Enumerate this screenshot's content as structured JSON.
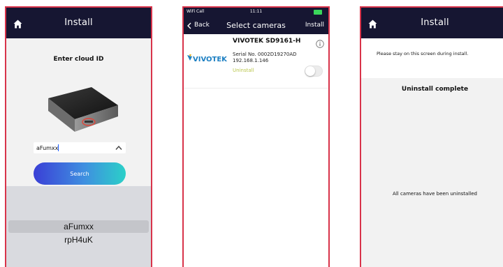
{
  "screen1": {
    "header_title": "Install",
    "cloud_label": "Enter cloud ID",
    "cloud_id_value": "aFumxx",
    "search_label": "Search",
    "picker_options": [
      "aFumxx",
      "rpH4uK"
    ]
  },
  "screen2": {
    "status": {
      "carrier": "WiFi Call",
      "time": "11:11"
    },
    "back_label": "Back",
    "title": "Select cameras",
    "install_label": "Install",
    "camera": {
      "name": "VIVOTEK SD9161-H",
      "brand": "VIVOTEK",
      "serial": "Serial No. 0002D19270AD",
      "ip": "192.168.1.146",
      "status": "Uninstall",
      "toggle_on": false
    }
  },
  "screen3": {
    "header_title": "Install",
    "notice": "Please stay on this screen during install.",
    "complete": "Uninstall complete",
    "all_uninstalled": "All cameras have been uninstalled"
  },
  "colors": {
    "header_bg": "#161632",
    "frame_border": "#d8334a",
    "search_gradient_start": "#3a3fd6",
    "search_gradient_end": "#2bd0c8",
    "uninstall_text": "#b9c64a"
  }
}
